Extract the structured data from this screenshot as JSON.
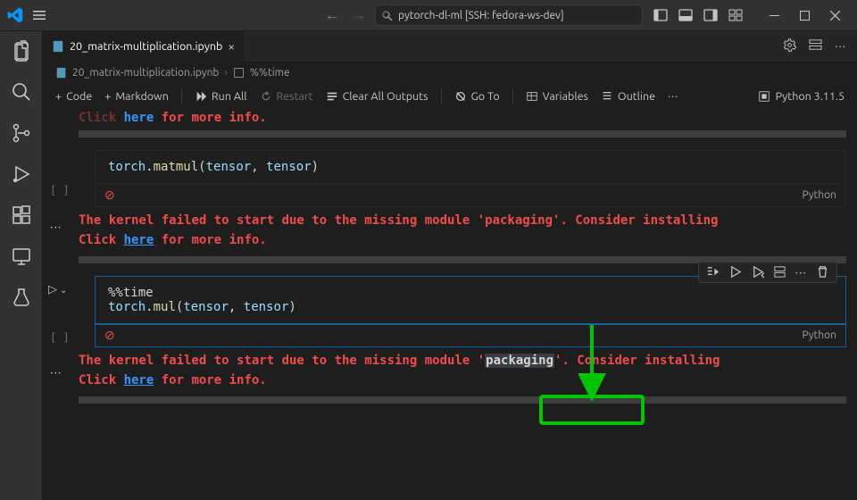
{
  "title": {
    "project": "pytorch-dl-ml",
    "remote": "[SSH: fedora-ws-dev]",
    "search_prefix": "pytorch-dl-ml [SSH: fedora-ws-dev]"
  },
  "tab": {
    "filename": "20_matrix-multiplication.ipynb"
  },
  "breadcrumb": {
    "file": "20_matrix-multiplication.ipynb",
    "symbol": "%%time"
  },
  "toolbar": {
    "code": "Code",
    "markdown": "Markdown",
    "run_all": "Run All",
    "restart": "Restart",
    "clear_outputs": "Clear All Outputs",
    "goto": "Go To",
    "variables": "Variables",
    "outline": "Outline",
    "kernel": "Python 3.11.5"
  },
  "frag_top": {
    "pre": "Click ",
    "link": "here",
    "post": " for more info."
  },
  "cells": [
    {
      "code_html": "torch.matmul(tensor, tensor)",
      "lang": "Python",
      "error": {
        "line1_pre": "The kernel failed to start due to the missing module 'packaging'. Consider installing",
        "line2_pre": "Click ",
        "link": "here",
        "line2_post": " for more info."
      }
    },
    {
      "code_line1": "%%time",
      "code_line2": "torch.mul(tensor, tensor)",
      "lang": "Python",
      "error": {
        "line1_pre": "The kernel failed to start due to the missing module '",
        "module": "packaging",
        "line1_post": "'. Consider installing",
        "line2_pre": "Click ",
        "link": "here",
        "line2_post": " for more info."
      }
    }
  ]
}
